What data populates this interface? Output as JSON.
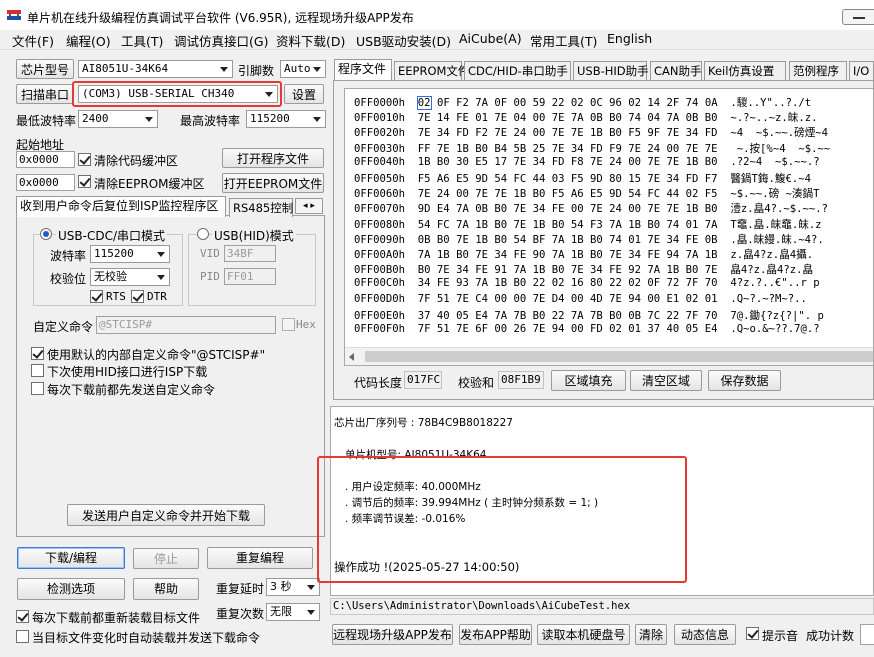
{
  "window": {
    "title": "单片机在线升级编程仿真调试平台软件 (V6.95R), 远程现场升级APP发布",
    "icon": "app-icon"
  },
  "menu": [
    "文件(F)",
    "编程(O)",
    "工具(T)",
    "调试仿真接口(G)",
    "资料下载(D)",
    "USB驱动安装(D)",
    "AiCube(A)",
    "常用工具(T)",
    "English"
  ],
  "left": {
    "chip_type_button": "芯片型号",
    "chip_type_value": "AI8051U-34K64",
    "pin_label": "引脚数",
    "pin_value": "Auto",
    "scan_port_button": "扫描串口",
    "port_value": "(COM3) USB-SERIAL CH340",
    "settings_button": "设置",
    "min_baud_label": "最低波特率",
    "min_baud_value": "2400",
    "max_baud_label": "最高波特率",
    "max_baud_value": "115200",
    "start_addr_label": "起始地址",
    "code_addr": "0x0000",
    "clear_code_label": "清除代码缓冲区",
    "open_prog_button": "打开程序文件",
    "eeprom_addr": "0x0000",
    "clear_eeprom_label": "清除EEPROM缓冲区",
    "open_eeprom_button": "打开EEPROM文件",
    "tab_isp": "收到用户命令后复位到ISP监控程序区",
    "tab_rs485": "RS485控制",
    "usb_cdc_label": "USB-CDC/串口模式",
    "usb_hid_label": "USB(HID)模式",
    "baud_label": "波特率",
    "baud_value": "115200",
    "parity_label": "校验位",
    "parity_value": "无校验",
    "rts_label": "RTS",
    "dtr_label": "DTR",
    "vid_label": "VID",
    "vid_value": "34BF",
    "pid_label": "PID",
    "pid_value": "FF01",
    "custom_cmd_label": "自定义命令",
    "custom_cmd_value": "@STCISP#",
    "hex_label": "Hex",
    "use_default_label": "使用默认的内部自定义命令\"@STCISP#\"",
    "next_hid_label": "下次使用HID接口进行ISP下载",
    "send_before_label": "每次下载前都先发送自定义命令",
    "send_custom_button": "发送用户自定义命令并开始下载",
    "download_button": "下载/编程",
    "stop_button": "停止",
    "reprog_button": "重复编程",
    "check_button": "检测选项",
    "help_button": "帮助",
    "repeat_delay_label": "重复延时",
    "repeat_delay_value": "3 秒",
    "repeat_count_label": "重复次数",
    "repeat_count_value": "无限",
    "reload_label": "每次下载前都重新装载目标文件",
    "autoload_label": "当目标文件变化时自动装载并发送下载命令"
  },
  "right": {
    "tabs": [
      "程序文件",
      "EEPROM文件",
      "CDC/HID-串口助手",
      "USB-HID助手",
      "CAN助手",
      "Keil仿真设置",
      "范例程序",
      "I/O"
    ],
    "hex_rows": [
      {
        "addr": "0FF0000h",
        "bytes": "02 0F F2 7A 0F 00 59 22 02 0C 96 02 14 2F 74 0A",
        "ascii": ".騣..Y\"..?./t"
      },
      {
        "addr": "0FF0010h",
        "bytes": "7E 14 FE 01 7E 04 00 7E 7A 0B B0 74 04 7A 0B B0",
        "ascii": "~.?~..~z.皌.z."
      },
      {
        "addr": "0FF0020h",
        "bytes": "7E 34 FD F2 7E 24 00 7E 7E 1B B0 F5 9F 7E 34 FD",
        "ascii": "~4  ~$.~~.磅煙~4"
      },
      {
        "addr": "0FF0030h",
        "bytes": "FF 7E 1B B0 B4 5B 25 7E 34 FD F9 7E 24 00 7E 7E",
        "ascii": " ~.按[%~4  ~$.~~"
      },
      {
        "addr": "0FF0040h",
        "bytes": "1B B0 30 E5 17 7E 34 FD F8 7E 24 00 7E 7E 1B B0",
        "ascii": ".?2~4  ~$.~~.?"
      },
      {
        "addr": "0FF0050h",
        "bytes": "F5 A6 E5 9D 54 FC 44 03 F5 9D 80 15 7E 34 FD F7",
        "ascii": "醫鍋T鋂.鰒€.~4  "
      },
      {
        "addr": "0FF0060h",
        "bytes": "7E 24 00 7E 7E 1B B0 F5 A6 E5 9D 54 FC 44 02 F5",
        "ascii": "~$.~~.磅 ~湊鍋T"
      },
      {
        "addr": "0FF0070h",
        "bytes": "9D E4 7A 0B B0 7E 34 FE 00 7E 24 00 7E 7E 1B B0",
        "ascii": "潱z.皛4?.~$.~~.?"
      },
      {
        "addr": "0FF0080h",
        "bytes": "54 FC 7A 1B B0 7E 1B B0 54 F3 7A 1B B0 74 01 7A",
        "ascii": "T鼀.皛.皌鼀.皌.z"
      },
      {
        "addr": "0FF0090h",
        "bytes": "0B B0 7E 1B B0 54 BF 7A 1B B0 74 01 7E 34 FE 0B",
        "ascii": ".皛.皌縵.皌.~4?."
      },
      {
        "addr": "0FF00A0h",
        "bytes": "7A 1B B0 7E 34 FE 90 7A 1B B0 7E 34 FE 94 7A 1B",
        "ascii": "z.皛4?z.皛4攝."
      },
      {
        "addr": "0FF00B0h",
        "bytes": "B0 7E 34 FE 91 7A 1B B0 7E 34 FE 92 7A 1B B0 7E",
        "ascii": "皛4?z.皛4?z.皛"
      },
      {
        "addr": "0FF00C0h",
        "bytes": "34 FE 93 7A 1B B0 22 02 16 80 22 02 0F 72 7F 70",
        "ascii": "4?z.?..€\"..r p"
      },
      {
        "addr": "0FF00D0h",
        "bytes": "7F 51 7E C4 00 00 7E D4 00 4D 7E 94 00 E1 02 01",
        "ascii": ".Q~?.~?M~?.."
      },
      {
        "addr": "0FF00E0h",
        "bytes": "37 40 05 E4 7A 7B B0 22 7A 7B B0 0B 7C 22 7F 70",
        "ascii": "7@.鋤{?z{?|\". p"
      },
      {
        "addr": "0FF00F0h",
        "bytes": "7F 51 7E 6F 00 26 7E 94 00 FD 02 01 37 40 05 E4",
        "ascii": ".Q~o.&~??.7@.?"
      }
    ],
    "code_len_label": "代码长度",
    "code_len_value": "017FC",
    "checksum_label": "校验和",
    "checksum_value": "08F1B9",
    "fill_button": "区域填充",
    "clear_button": "清空区域",
    "save_button": "保存数据",
    "output_lines": {
      "serial": "芯片出厂序列号 : 78B4C9B8018227",
      "model": "单片机型号: AI8051U-34K64",
      "freq_set": ". 用户设定频率: 40.000MHz",
      "freq_adj": ". 调节后的频率: 39.994MHz ( 主时钟分频系数 = 1; )",
      "freq_err": ". 频率调节误差: -0.016%",
      "success": "操作成功 !(2025-05-27 14:00:50)"
    },
    "file_path": "C:\\Users\\Administrator\\Downloads\\AiCubeTest.hex",
    "bottom_buttons": [
      "远程现场升级APP发布",
      "发布APP帮助",
      "读取本机硬盘号",
      "清除",
      "动态信息"
    ],
    "beep_label": "提示音",
    "success_count_label": "成功计数"
  },
  "colors": {
    "highlight_red": "#e53935",
    "selection_blue": "#2f6fd6"
  }
}
